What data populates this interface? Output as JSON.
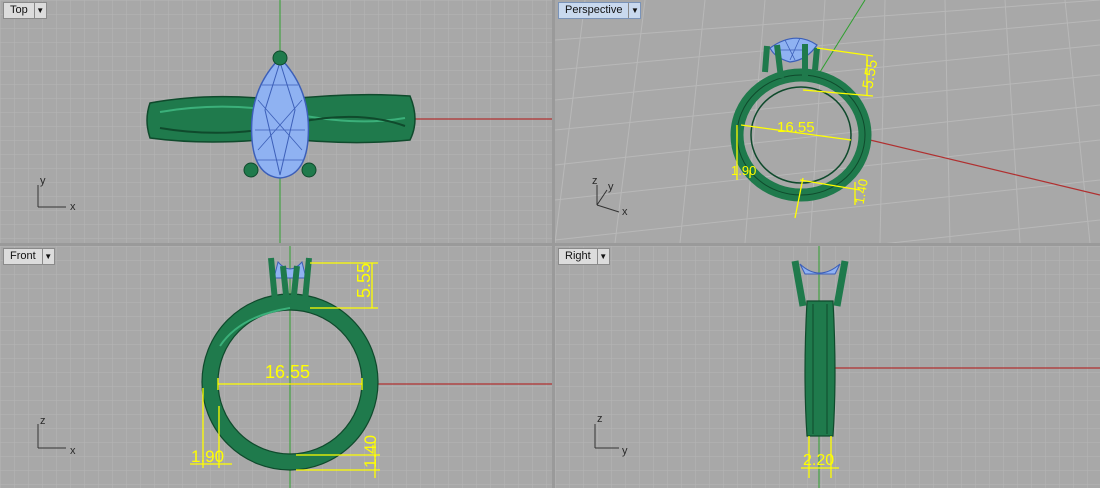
{
  "viewports": {
    "top": {
      "label": "Top",
      "axis_x": "x",
      "axis_y": "y"
    },
    "perspective": {
      "label": "Perspective",
      "axis_x": "x",
      "axis_y": "y",
      "axis_z": "z"
    },
    "front": {
      "label": "Front",
      "axis_x": "x",
      "axis_z": "z"
    },
    "right": {
      "label": "Right",
      "axis_y": "y",
      "axis_z": "z"
    }
  },
  "dimensions": {
    "inner_diameter": "16.55",
    "prong_height": "5.55",
    "shank_width": "1.90",
    "shank_thickness": "1.40",
    "band_width": "2.20"
  },
  "icons": {
    "dropdown": "chevron-down-icon"
  },
  "colors": {
    "viewport_bg": "#a8a8a8",
    "grid": "#b4b4b4",
    "ring_metal": "#1f7a4c",
    "gem": "#8fb2f2",
    "dimension": "#ffff00",
    "x_axis": "#b03030",
    "y_axis": "#2fa02f"
  }
}
